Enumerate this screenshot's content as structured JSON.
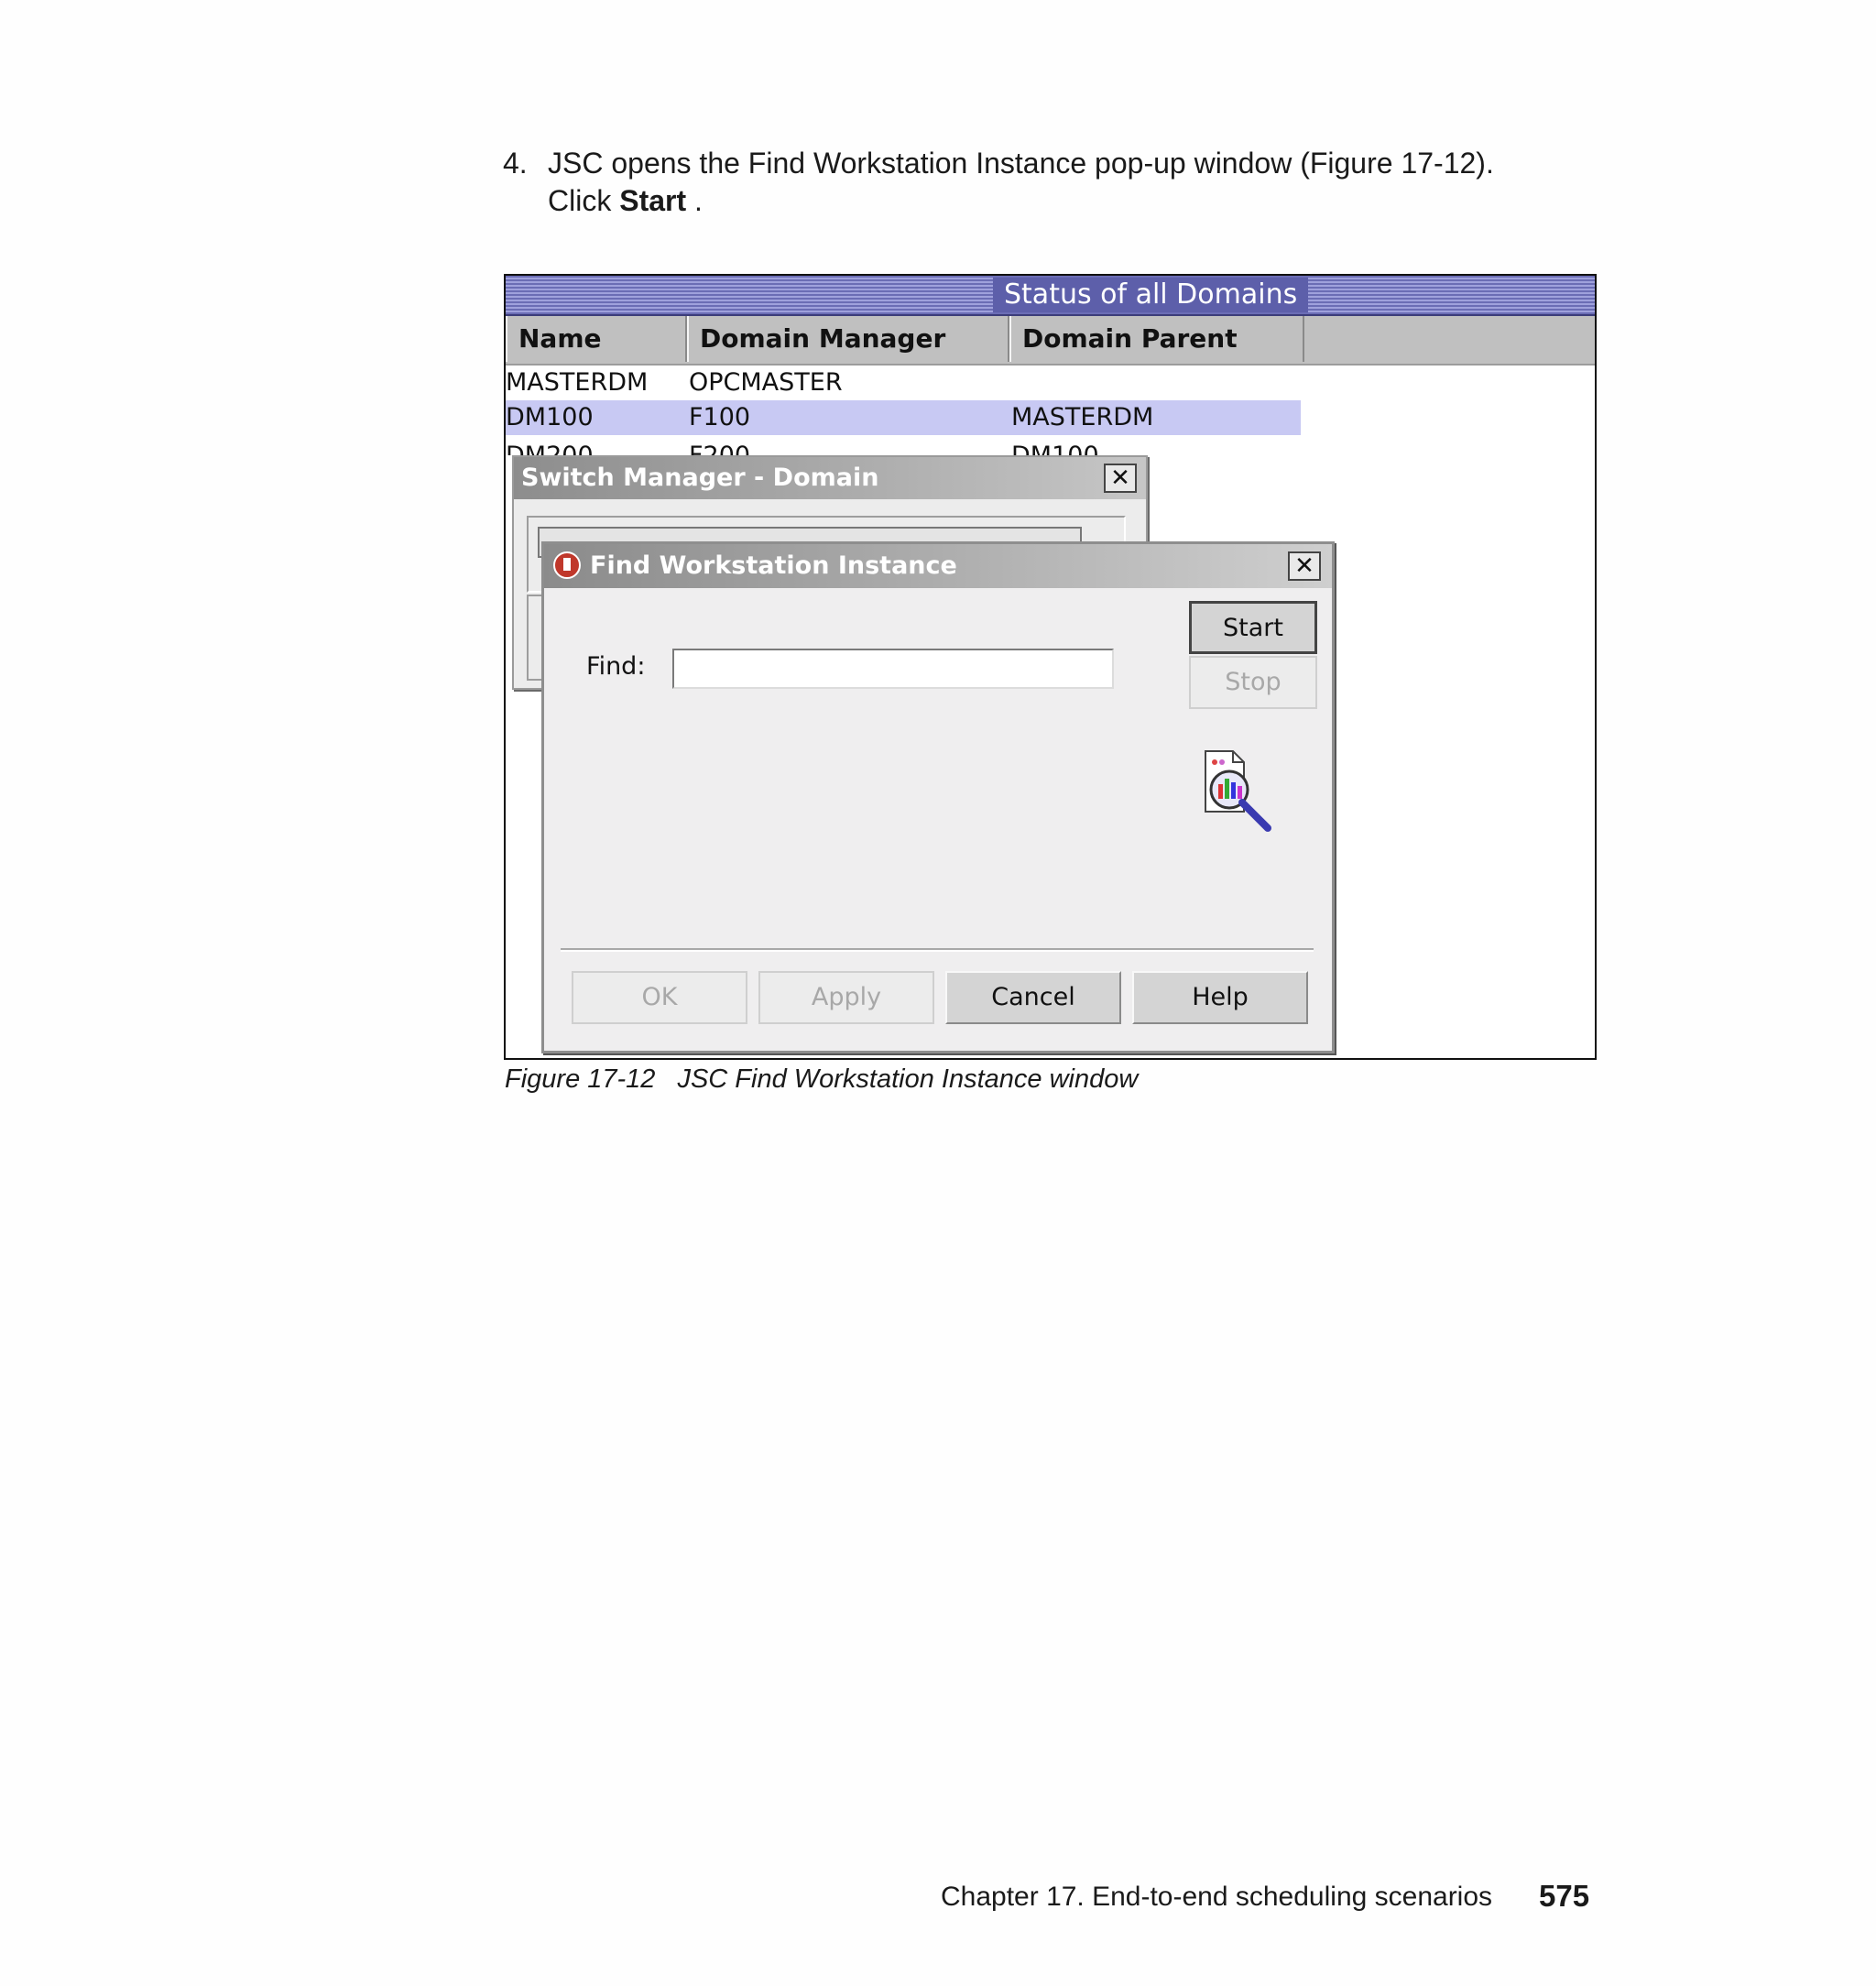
{
  "instruction": {
    "number": "4.",
    "text": "JSC opens the Find Workstation Instance pop-up window (Figure 17-12).",
    "click_prefix": "Click ",
    "click_bold": "Start",
    "click_suffix": " ."
  },
  "status_window": {
    "title": "Status of all Domains",
    "columns": [
      "Name",
      "Domain Manager",
      "Domain Parent"
    ],
    "rows": [
      {
        "name": "MASTERDM",
        "manager": "OPCMASTER",
        "parent": "",
        "selected": false
      },
      {
        "name": "DM100",
        "manager": "F100",
        "parent": "MASTERDM",
        "selected": true
      },
      {
        "name": "DM200",
        "manager": "F200",
        "parent": "DM100",
        "selected": false
      }
    ]
  },
  "switch_manager": {
    "title": "Switch Manager - Domain",
    "close": "✕"
  },
  "find_dialog": {
    "title": "Find Workstation Instance",
    "close": "✕",
    "find_label": "Find:",
    "find_value": "",
    "start_label": "Start",
    "stop_label": "Stop",
    "ok_label": "OK",
    "apply_label": "Apply",
    "cancel_label": "Cancel",
    "help_label": "Help",
    "icon": "search-document-icon"
  },
  "caption": {
    "figure": "Figure 17-12",
    "text": "JSC Find Workstation Instance window"
  },
  "footer": {
    "chapter": "Chapter 17. End-to-end scheduling scenarios",
    "page": "575"
  }
}
